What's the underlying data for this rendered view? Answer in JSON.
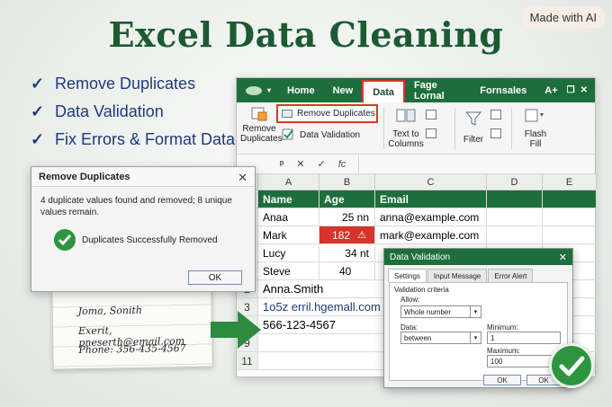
{
  "title": "Excel Data Cleaning",
  "badge": "Made with AI",
  "bullets": [
    "Remove Duplicates",
    "Data Validation",
    "Fix Errors & Format Data"
  ],
  "excel": {
    "tabs": [
      "Home",
      "New",
      "Data",
      "Fage Lornal",
      "Fornsales",
      "A+"
    ],
    "ribbon": {
      "remove_duplicates": "Remove Duplicates",
      "remove_duplicates_big_1": "Remove",
      "remove_duplicates_big_2": "Duplicates",
      "data_validation": "Data Validation",
      "text_to_columns_1": "Text to",
      "text_to_columns_2": "Columns",
      "filter": "Filter",
      "flash_fill_1": "Flash",
      "flash_fill_2": "Fill"
    },
    "formula_bar": [
      "✕",
      "✓",
      "fc"
    ],
    "columns": [
      "A",
      "B",
      "C",
      "D",
      "E"
    ],
    "header_row": [
      "Name",
      "Age",
      "Email"
    ],
    "rows": [
      {
        "num": "",
        "name": "Anaa",
        "age": "25 nn",
        "email": "anna@example.com",
        "flag": false
      },
      {
        "num": "",
        "name": "Mark",
        "age": "182",
        "email": "mark@example.com",
        "flag": true
      },
      {
        "num": "",
        "name": "Lucy",
        "age": "34 nt",
        "email": "",
        "flag": false
      },
      {
        "num": "",
        "name": "Steve",
        "age": "40",
        "email": "",
        "flag": false
      }
    ],
    "lower_rows": [
      {
        "num": "2",
        "value": "Anna.Smith"
      },
      {
        "num": "3",
        "value": "1o5z erril.hgemall.com"
      },
      {
        "num": "8",
        "value": "566-123-4567"
      },
      {
        "num": "9",
        "value": ""
      },
      {
        "num": "11",
        "value": ""
      }
    ]
  },
  "remove_dialog": {
    "title": "Remove Duplicates",
    "message": "4 duplicate values found and removed; 8 unique values remain.",
    "success": "Duplicates Successfully Removed",
    "ok": "OK"
  },
  "note": {
    "line1": "Joma, Sonith",
    "line2": "Exerit, pneserth@email.com",
    "line3": "Phone: 356-435-4567"
  },
  "validation_dialog": {
    "title": "Data Validation",
    "tabs": [
      "Settings",
      "Input Message",
      "Error Alert"
    ],
    "criteria": "Validation criteria",
    "allow_label": "Allow:",
    "allow_value": "Whole number",
    "data_label": "Data:",
    "data_value": "between",
    "min_label": "Minimum:",
    "min_value": "1",
    "max_label": "Maximum:",
    "max_value": "100",
    "ok1": "OK",
    "ok2": "OK"
  },
  "colors": {
    "accent": "#1e6e3c",
    "title": "#1c5a32",
    "error": "#d6342a",
    "bullet": "#1d3a7a"
  }
}
